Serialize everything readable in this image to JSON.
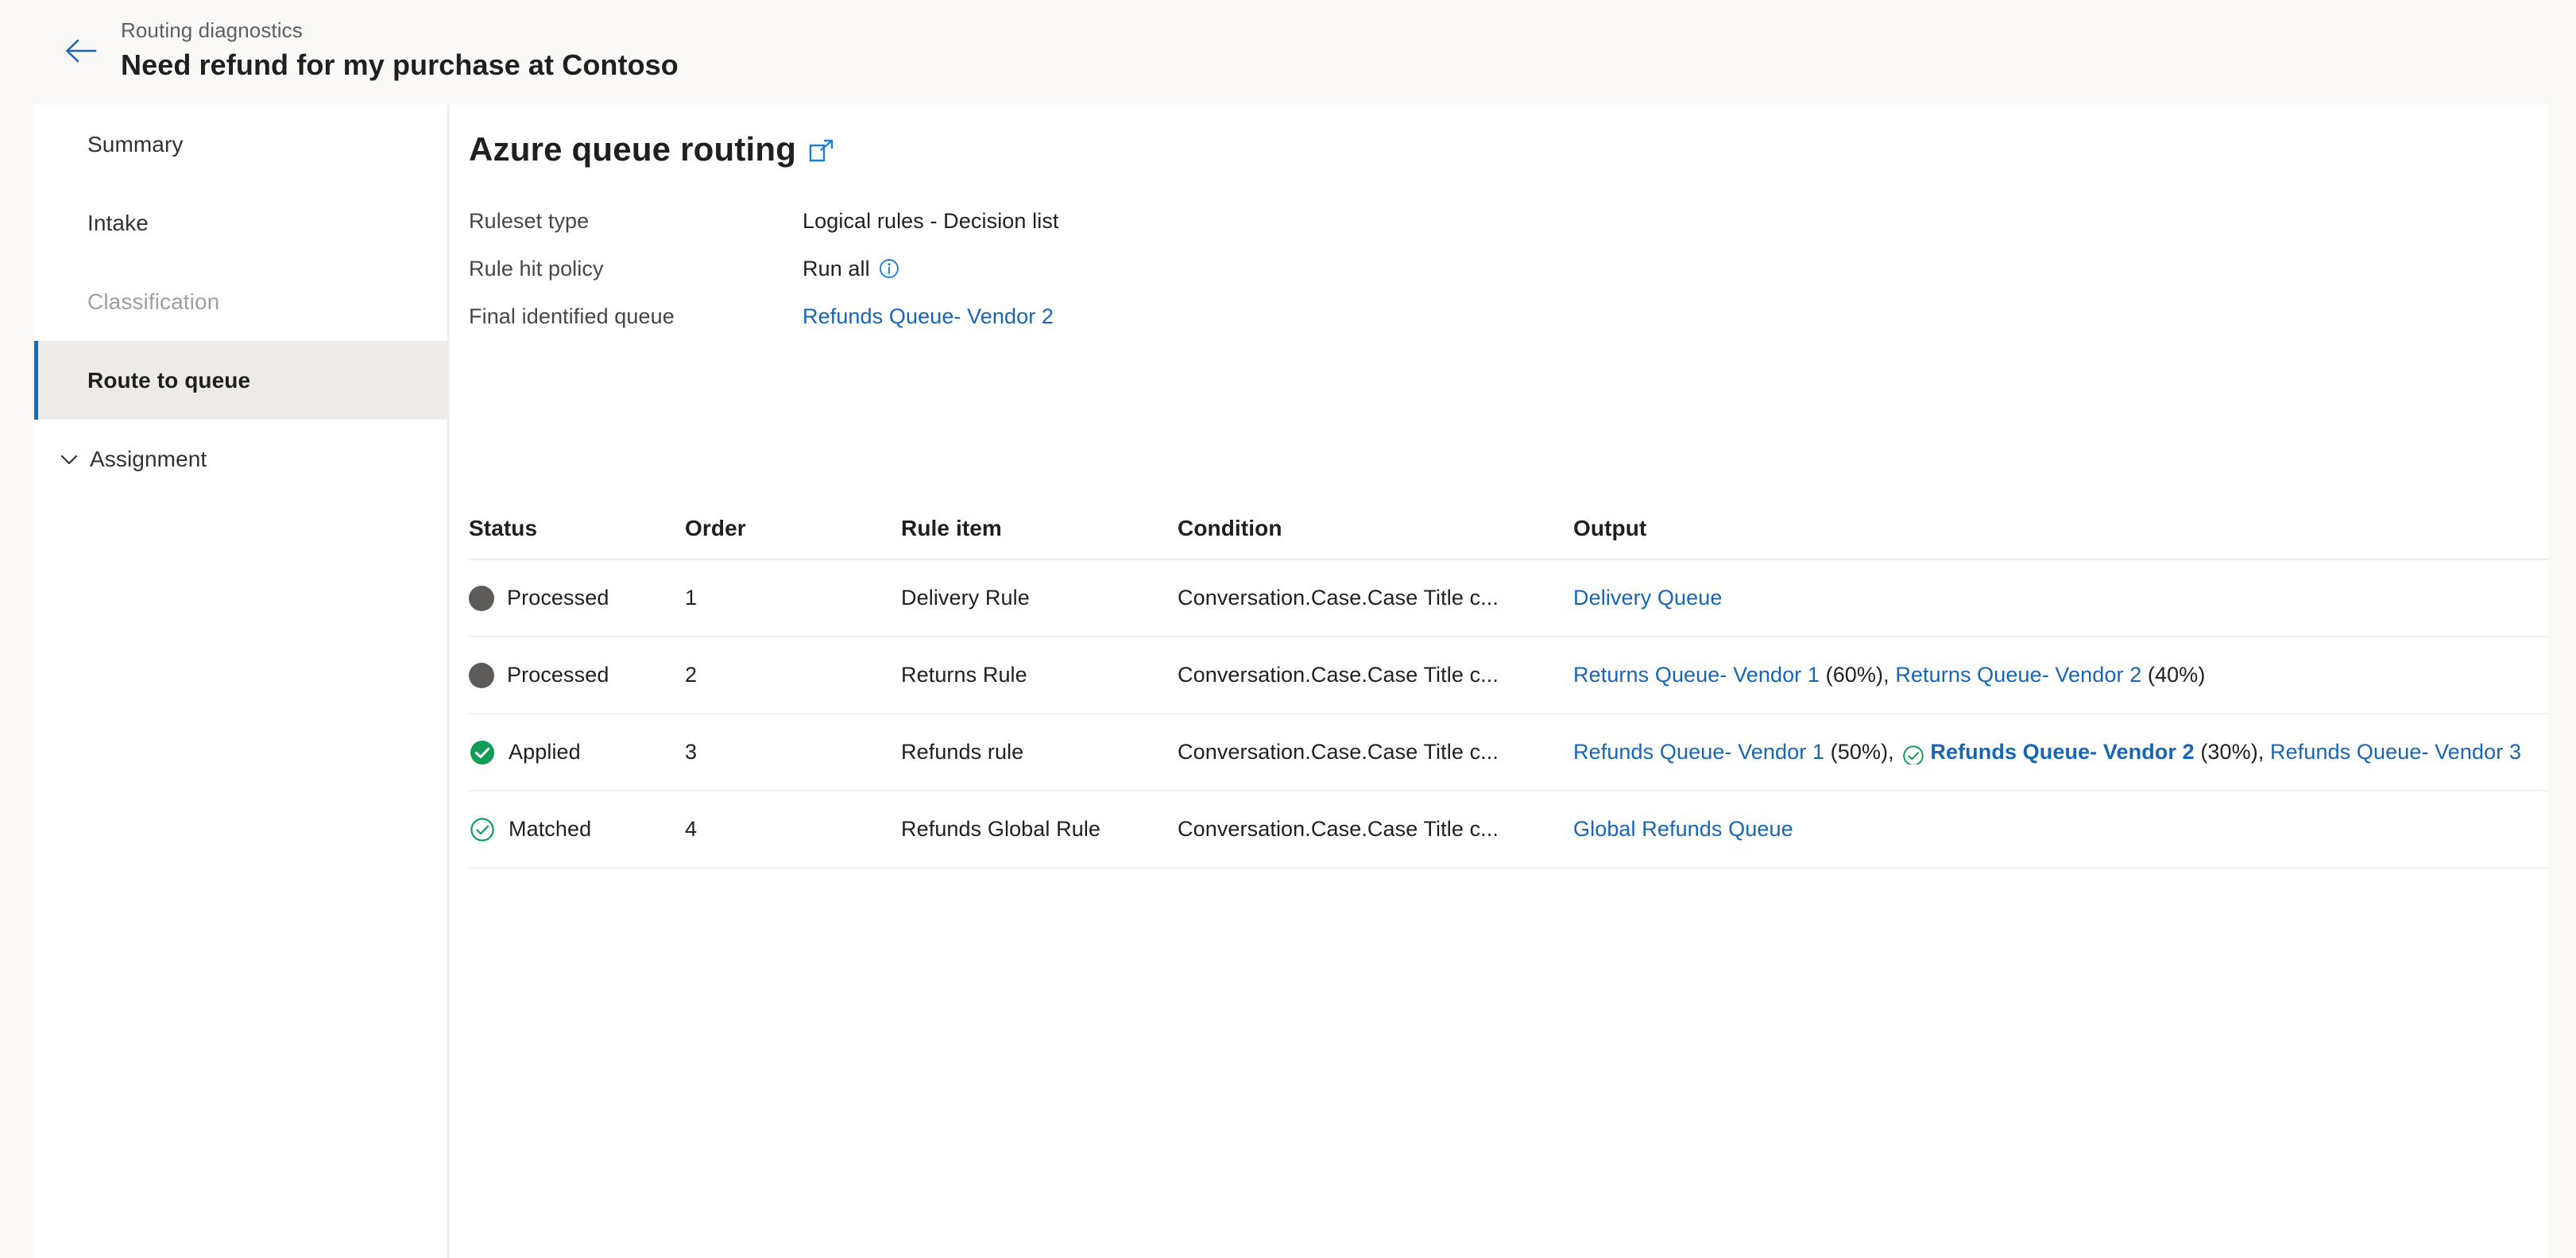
{
  "header": {
    "back_icon": "arrow-left-icon",
    "breadcrumb": "Routing diagnostics",
    "record_title": "Need refund for my purchase at Contoso"
  },
  "sidebar": {
    "items": [
      {
        "label": "Summary",
        "state": "normal",
        "icon": null
      },
      {
        "label": "Intake",
        "state": "normal",
        "icon": null
      },
      {
        "label": "Classification",
        "state": "disabled",
        "icon": null
      },
      {
        "label": "Route to queue",
        "state": "selected",
        "icon": null
      },
      {
        "label": "Assignment",
        "state": "group",
        "icon": "chevron-down-icon"
      }
    ]
  },
  "content": {
    "section_title": "Azure queue routing",
    "section_title_icon": "open-in-new-window-icon",
    "properties": [
      {
        "key": "Ruleset type",
        "value": "Logical rules - Decision list",
        "is_link": false,
        "has_info": false
      },
      {
        "key": "Rule hit policy",
        "value": "Run all",
        "is_link": false,
        "has_info": true,
        "info_icon": "info-icon"
      },
      {
        "key": "Final identified queue",
        "value": "Refunds Queue- Vendor 2",
        "is_link": true,
        "has_info": false
      }
    ],
    "table": {
      "columns": [
        "Status",
        "Order",
        "Rule item",
        "Condition",
        "Output"
      ],
      "rows": [
        {
          "status": "Processed",
          "status_icon": "filled-gray-circle-icon",
          "order": "1",
          "rule_item": "Delivery Rule",
          "condition": "Conversation.Case.Case Title c...",
          "output_segments": [
            {
              "text": "Delivery Queue",
              "type": "link",
              "bold": false,
              "check": false
            }
          ]
        },
        {
          "status": "Processed",
          "status_icon": "filled-gray-circle-icon",
          "order": "2",
          "rule_item": "Returns Rule",
          "condition": "Conversation.Case.Case Title c...",
          "output_segments": [
            {
              "text": "Returns Queue- Vendor 1",
              "type": "link",
              "bold": false,
              "check": false
            },
            {
              "text": " (60%), ",
              "type": "plain",
              "bold": false,
              "check": false
            },
            {
              "text": "Returns Queue- Vendor 2",
              "type": "link",
              "bold": false,
              "check": false
            },
            {
              "text": " (40%)",
              "type": "plain",
              "bold": false,
              "check": false
            }
          ]
        },
        {
          "status": "Applied",
          "status_icon": "green-filled-check-circle-icon",
          "order": "3",
          "rule_item": "Refunds rule",
          "condition": "Conversation.Case.Case Title c...",
          "output_segments": [
            {
              "text": "Refunds Queue- Vendor 1",
              "type": "link",
              "bold": false,
              "check": false
            },
            {
              "text": " (50%), ",
              "type": "plain",
              "bold": false,
              "check": false
            },
            {
              "text": "Refunds Queue- Vendor 2",
              "type": "link",
              "bold": true,
              "check": true
            },
            {
              "text": " (30%), ",
              "type": "plain",
              "bold": false,
              "check": false
            },
            {
              "text": "Refunds Queue- Vendor 3",
              "type": "link",
              "bold": false,
              "check": false
            }
          ]
        },
        {
          "status": "Matched",
          "status_icon": "green-outline-check-circle-icon",
          "order": "4",
          "rule_item": "Refunds Global Rule",
          "condition": "Conversation.Case.Case Title c...",
          "output_segments": [
            {
              "text": "Global Refunds Queue",
              "type": "link",
              "bold": false,
              "check": false
            }
          ]
        }
      ]
    }
  },
  "colors": {
    "accent_blue": "#0f6cbd",
    "link_blue": "#1765b5",
    "success_green": "#0f9d58",
    "neutral_dot": "#5d5a58",
    "page_background": "#faf9f8",
    "panel_background": "#ffffff",
    "selected_row": "#edebe9"
  }
}
